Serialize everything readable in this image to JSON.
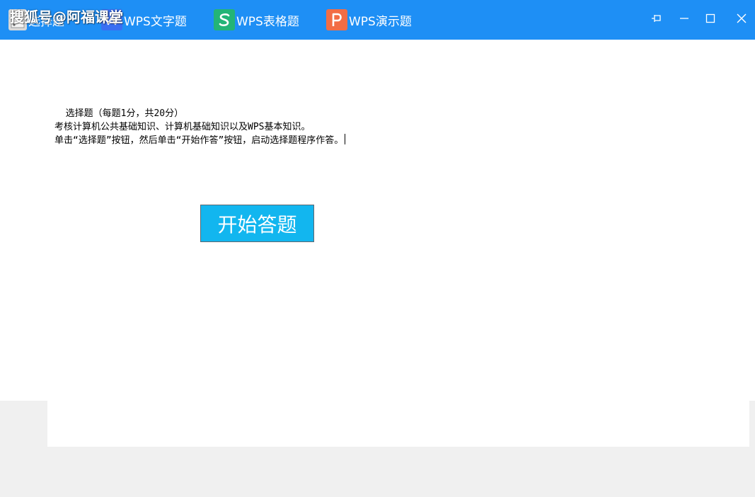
{
  "watermark": "搜狐号@阿福课堂",
  "tabs": [
    {
      "label": "选择题",
      "icon": "choice-icon",
      "color": "#d9d9d9"
    },
    {
      "label": "WPS文字题",
      "icon": "wps-writer-icon",
      "color": "#3a6ff2"
    },
    {
      "label": "WPS表格题",
      "icon": "wps-spreadsheet-icon",
      "color": "#23b477"
    },
    {
      "label": "WPS演示题",
      "icon": "wps-presentation-icon",
      "color": "#f26d45"
    }
  ],
  "window_controls": [
    "pin-icon",
    "minimize-icon",
    "maximize-icon",
    "close-icon"
  ],
  "description": {
    "line1": "  选择题（每题1分，共20分）",
    "line2": "考核计算机公共基础知识、计算机基础知识以及WPS基本知识。",
    "line3": "单击“选择题”按钮，然后单击“开始作答”按钮，启动选择题程序作答。"
  },
  "start_button": "开始答题",
  "colors": {
    "titlebar": "#1e8ff5",
    "start_button": "#12b6ef",
    "background": "#f0f0f0"
  }
}
